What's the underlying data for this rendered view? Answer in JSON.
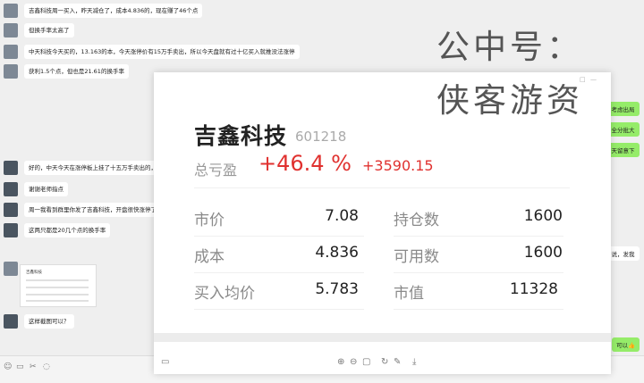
{
  "chat": {
    "messages": [
      {
        "text": "吉鑫科技周一买入，昨天减仓了，成本4.836的，现在赚了46个点"
      },
      {
        "text": "但换手率太高了"
      },
      {
        "text": "中天科技今天买的，13.163的本，今天涨停价有15万手卖出，所以今天盘就有过十亿买入就推没法涨停"
      },
      {
        "text": "获利1.5个点，但也是21.61的换手率"
      },
      {
        "text": "好的，中天今天在涨停板上挂了十五万手卖出的，"
      },
      {
        "text": "谢谢老师指点"
      },
      {
        "text": "周一我看到群里你发了吉鑫科技，开盘很快涨停了"
      },
      {
        "text": "这两只都是20几个点的换手率"
      },
      {
        "text": "这样截图可以？"
      }
    ],
    "right_messages": [
      {
        "text": "以考虑出局"
      },
      {
        "text": "部全分批大"
      },
      {
        "text": "明天留意下"
      },
      {
        "text": "有说，发我"
      },
      {
        "text": "可以👍"
      }
    ],
    "thumbnail": {
      "title": "吉鑫科技"
    }
  },
  "bottom_bar": {
    "icons": [
      "smile-icon",
      "folder-icon",
      "scissors-icon",
      "chat-bubble-icon"
    ]
  },
  "viewer": {
    "stock_name": "吉鑫科技",
    "stock_code": "601218",
    "pnl_label": "总亏盈",
    "pnl_percent": "+46.4 %",
    "pnl_amount": "+3590.15",
    "rows": [
      {
        "left_label": "市价",
        "left_value": "7.08",
        "right_label": "持仓数",
        "right_value": "1600"
      },
      {
        "left_label": "成本",
        "left_value": "4.836",
        "right_label": "可用数",
        "right_value": "1600"
      },
      {
        "left_label": "买入均价",
        "left_value": "5.783",
        "right_label": "市值",
        "right_value": "11328"
      }
    ],
    "window_controls": [
      "□",
      "—",
      "□",
      "✕"
    ],
    "toolbar_icons": [
      "screen-icon",
      "zoom-in-icon",
      "zoom-out-icon",
      "fit-icon",
      "rotate-icon",
      "edit-icon",
      "download-icon"
    ]
  },
  "watermark": {
    "line1": "公中号：",
    "line2": "侠客游资"
  },
  "colors": {
    "profit_red": "#e0312f",
    "bubble_green": "#95ec69"
  }
}
